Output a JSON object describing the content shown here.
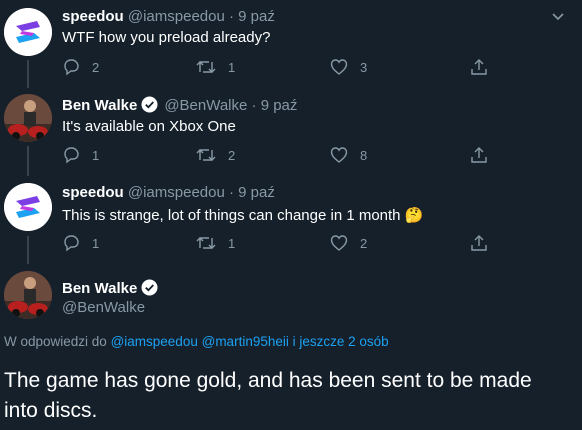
{
  "tweets": [
    {
      "name": "speedou",
      "handle": "@iamspeedou",
      "date": "9 paź",
      "text": "WTF how you preload already?",
      "replies": "2",
      "retweets": "1",
      "likes": "3"
    },
    {
      "name": "Ben Walke",
      "handle": "@BenWalke",
      "date": "9 paź",
      "text": "It's available on Xbox One",
      "replies": "1",
      "retweets": "2",
      "likes": "8"
    },
    {
      "name": "speedou",
      "handle": "@iamspeedou",
      "date": "9 paź",
      "text": "This is strange, lot of things can change in 1 month 🤔",
      "replies": "1",
      "retweets": "1",
      "likes": "2"
    }
  ],
  "main_tweet": {
    "name": "Ben Walke",
    "handle": "@BenWalke",
    "reply_prefix": "W odpowiedzi do",
    "reply_user1": "@iamspeedou",
    "reply_user2": "@martin95heii",
    "reply_suffix": "i jeszcze 2 osób",
    "text": "The game has gone gold, and has been sent to be made into discs."
  },
  "colors": {
    "background": "#15202b",
    "secondary_text": "#8899a6",
    "link": "#1da1f2",
    "verified": "#ffffff"
  }
}
